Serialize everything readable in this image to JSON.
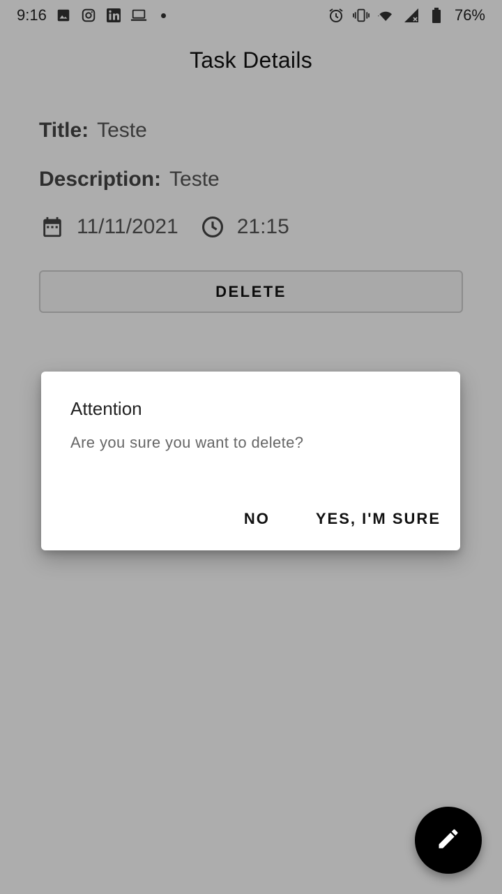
{
  "status_bar": {
    "time": "9:16",
    "battery": "76%",
    "left_icons": [
      "image-icon",
      "instagram-icon",
      "linkedin-icon",
      "laptop-icon",
      "notification-dot-icon"
    ],
    "right_icons": [
      "alarm-icon",
      "vibrate-icon",
      "wifi-icon",
      "signal-icon",
      "battery-icon"
    ]
  },
  "page": {
    "title": "Task Details"
  },
  "task": {
    "title_label": "Title:",
    "title_value": "Teste",
    "description_label": "Description:",
    "description_value": "Teste",
    "date": "11/11/2021",
    "time": "21:15"
  },
  "actions": {
    "delete_label": "DELETE"
  },
  "dialog": {
    "title": "Attention",
    "message": "Are you sure you want to delete?",
    "no_label": "NO",
    "yes_label": "YES, I'M SURE"
  },
  "fab": {
    "icon": "edit-pencil-icon"
  },
  "colors": {
    "fab_background": "#000000",
    "dialog_background": "#ffffff",
    "scrim": "rgba(0,0,0,0.32)"
  }
}
